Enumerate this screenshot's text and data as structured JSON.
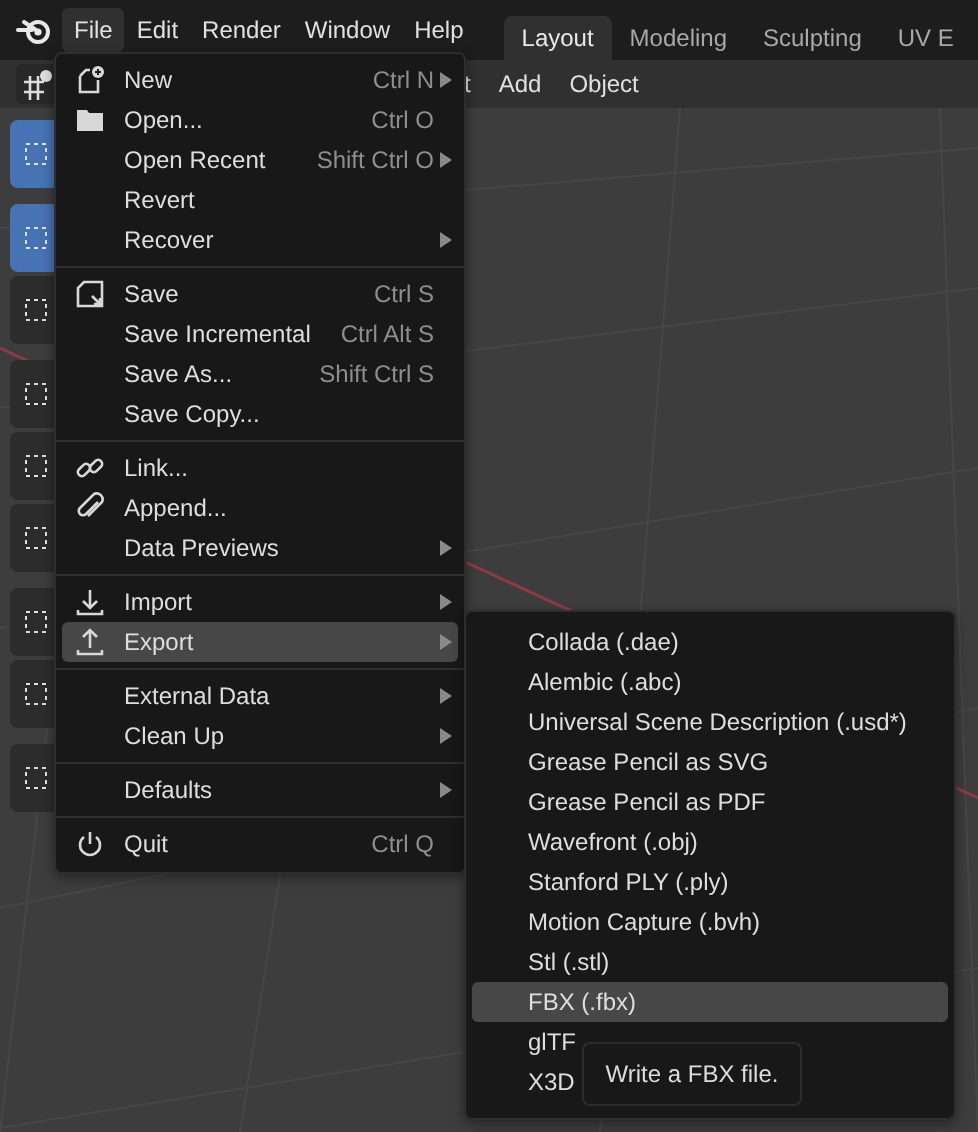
{
  "topbar": {
    "menus": [
      {
        "label": "File",
        "selected": true
      },
      {
        "label": "Edit",
        "selected": false
      },
      {
        "label": "Render",
        "selected": false
      },
      {
        "label": "Window",
        "selected": false
      },
      {
        "label": "Help",
        "selected": false
      }
    ],
    "workspaces": [
      {
        "label": "Layout",
        "selected": true
      },
      {
        "label": "Modeling",
        "selected": false
      },
      {
        "label": "Sculpting",
        "selected": false
      },
      {
        "label": "UV E",
        "selected": false
      }
    ]
  },
  "header": {
    "menus": [
      "t",
      "Add",
      "Object"
    ]
  },
  "toolbar": {
    "tools": [
      {
        "selected": true
      },
      {
        "selected": true
      },
      {
        "selected": false
      },
      {
        "selected": false
      },
      {
        "selected": false
      },
      {
        "selected": false
      },
      {
        "selected": false
      },
      {
        "selected": false
      },
      {
        "selected": false
      }
    ]
  },
  "file_menu": {
    "sections": [
      [
        {
          "label": "New",
          "shortcut": "Ctrl N",
          "submenu": true,
          "selected": false
        },
        {
          "label": "Open...",
          "shortcut": "Ctrl O",
          "submenu": false,
          "selected": false
        },
        {
          "label": "Open Recent",
          "shortcut": "Shift Ctrl O",
          "submenu": true,
          "selected": false
        },
        {
          "label": "Revert",
          "submenu": false,
          "selected": false
        },
        {
          "label": "Recover",
          "submenu": true,
          "selected": false
        }
      ],
      [
        {
          "label": "Save",
          "shortcut": "Ctrl S",
          "submenu": false,
          "selected": false
        },
        {
          "label": "Save Incremental",
          "shortcut": "Ctrl Alt S",
          "submenu": false,
          "selected": false
        },
        {
          "label": "Save As...",
          "shortcut": "Shift Ctrl S",
          "submenu": false,
          "selected": false
        },
        {
          "label": "Save Copy...",
          "submenu": false,
          "selected": false
        }
      ],
      [
        {
          "label": "Link...",
          "submenu": false,
          "selected": false
        },
        {
          "label": "Append...",
          "submenu": false,
          "selected": false
        },
        {
          "label": "Data Previews",
          "submenu": true,
          "selected": false
        }
      ],
      [
        {
          "label": "Import",
          "submenu": true,
          "selected": false
        },
        {
          "label": "Export",
          "submenu": true,
          "selected": true
        }
      ],
      [
        {
          "label": "External Data",
          "submenu": true,
          "selected": false
        },
        {
          "label": "Clean Up",
          "submenu": true,
          "selected": false
        }
      ],
      [
        {
          "label": "Defaults",
          "submenu": true,
          "selected": false
        }
      ],
      [
        {
          "label": "Quit",
          "shortcut": "Ctrl Q",
          "submenu": false,
          "selected": false
        }
      ]
    ]
  },
  "export_menu": {
    "items": [
      {
        "label": "Collada (.dae)",
        "selected": false
      },
      {
        "label": "Alembic (.abc)",
        "selected": false
      },
      {
        "label": "Universal Scene Description (.usd*)",
        "selected": false
      },
      {
        "label": "Grease Pencil as SVG",
        "selected": false
      },
      {
        "label": "Grease Pencil as PDF",
        "selected": false
      },
      {
        "label": "Wavefront (.obj)",
        "selected": false
      },
      {
        "label": "Stanford PLY (.ply)",
        "selected": false
      },
      {
        "label": "Motion Capture (.bvh)",
        "selected": false
      },
      {
        "label": "Stl (.stl)",
        "selected": false
      },
      {
        "label": "FBX (.fbx)",
        "selected": true
      },
      {
        "label": "glTF",
        "selected": false
      },
      {
        "label": "X3D",
        "selected": false
      }
    ]
  },
  "tooltip": {
    "text": "Write a FBX file."
  }
}
